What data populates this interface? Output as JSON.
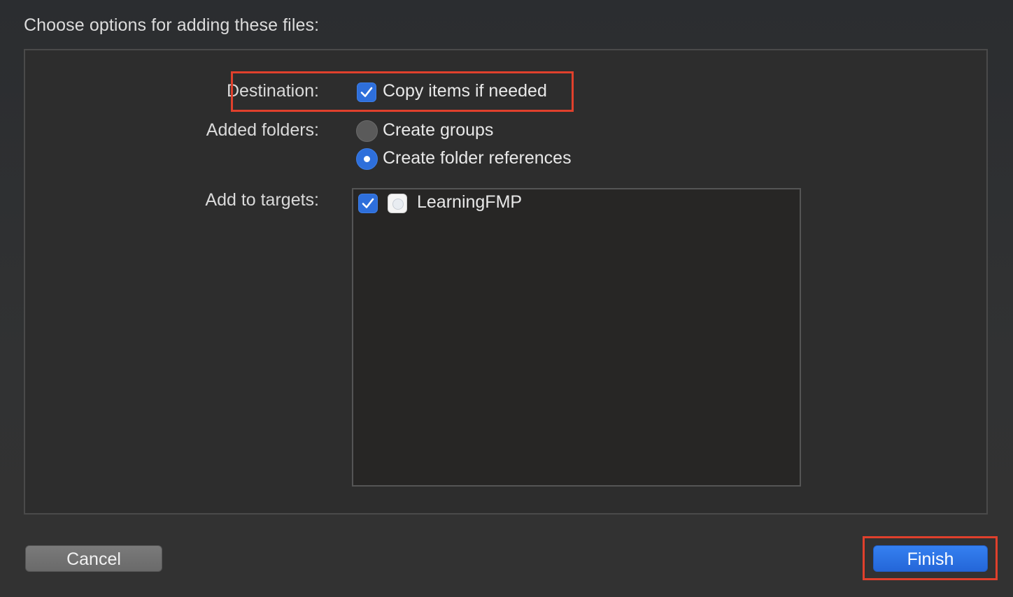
{
  "dialog": {
    "heading": "Choose options for adding these files:"
  },
  "destination": {
    "label": "Destination:",
    "copy_items_label": "Copy items if needed",
    "copy_items_checked": true
  },
  "added_folders": {
    "label": "Added folders:",
    "options": [
      {
        "label": "Create groups",
        "selected": false
      },
      {
        "label": "Create folder references",
        "selected": true
      }
    ]
  },
  "targets": {
    "label": "Add to targets:",
    "items": [
      {
        "name": "LearningFMP",
        "checked": true,
        "icon": "app-target-icon"
      }
    ]
  },
  "buttons": {
    "cancel": "Cancel",
    "finish": "Finish"
  },
  "colors": {
    "accent": "#2e6fdb",
    "highlight": "#e0402c",
    "background": "#323232"
  }
}
